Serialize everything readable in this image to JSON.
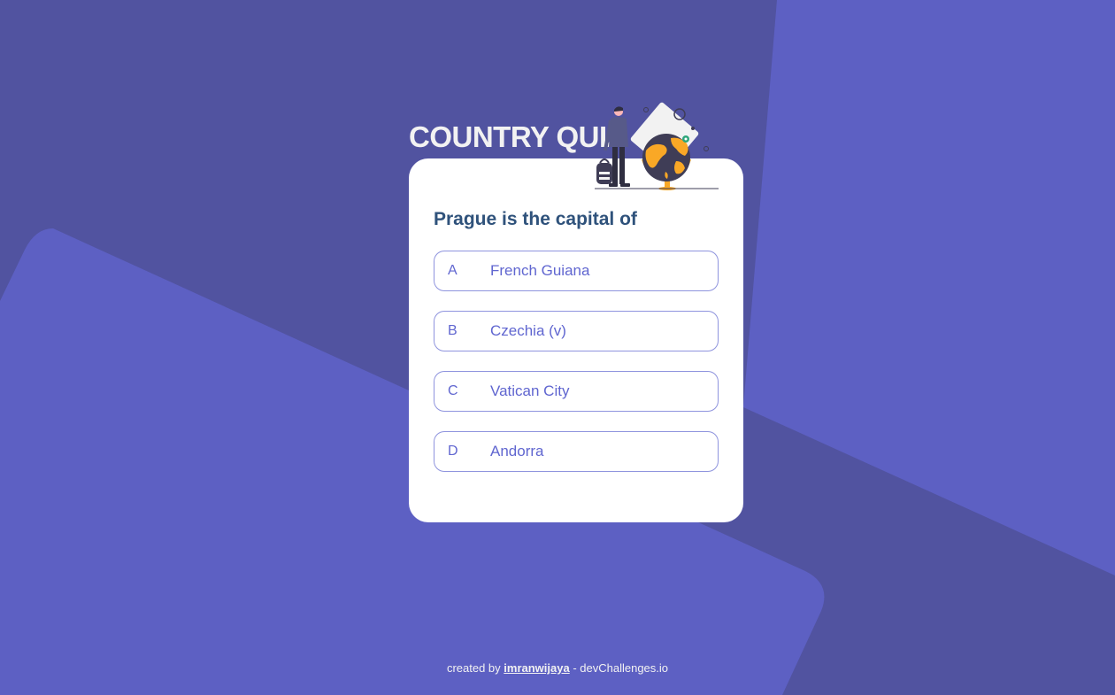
{
  "quiz": {
    "title": "COUNTRY QUIZ",
    "question": "Prague is the capital of",
    "options": [
      {
        "letter": "A",
        "answer": "French Guiana"
      },
      {
        "letter": "B",
        "answer": "Czechia (v)"
      },
      {
        "letter": "C",
        "answer": "Vatican City"
      },
      {
        "letter": "D",
        "answer": "Andorra"
      }
    ]
  },
  "footer": {
    "prefix": "created by",
    "author": "imranwijaya",
    "suffix": "- devChallenges.io"
  },
  "colors": {
    "background": "#5153a0",
    "background_shape": "#5d60c3",
    "title": "#f2f2f2",
    "question": "#2f527b",
    "option_accent": "#6066d0",
    "globe_accent": "#f9a826"
  },
  "icons": {
    "illustration": "traveler-with-globe-illustration"
  }
}
